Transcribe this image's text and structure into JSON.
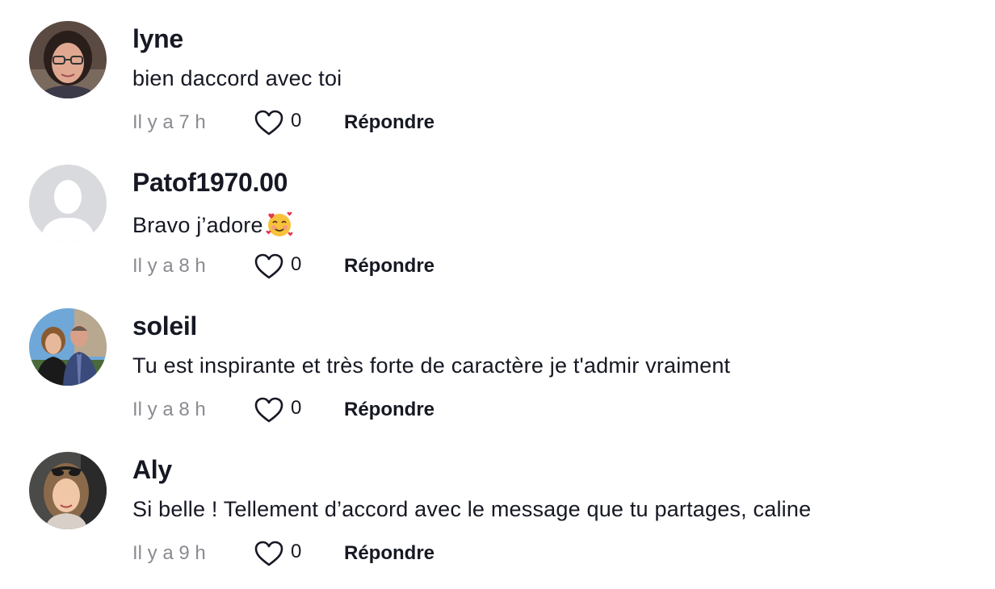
{
  "comments": [
    {
      "username": "lyne",
      "text": "bien daccord avec toi",
      "time": "Il y a 7 h",
      "likes": "0",
      "reply_label": "Répondre",
      "avatar": "photo-woman-glasses-avatar"
    },
    {
      "username": "Patof1970.00",
      "text": "Bravo j’adore",
      "emoji": "smiling-face-with-hearts",
      "time": "Il y a 8 h",
      "likes": "0",
      "reply_label": "Répondre",
      "avatar": "default-user-avatar"
    },
    {
      "username": "soleil",
      "text": "Tu est inspirante et très forte de caractère je t'admir vraiment",
      "time": "Il y a 8 h",
      "likes": "0",
      "reply_label": "Répondre",
      "avatar": "photo-couple-avatar"
    },
    {
      "username": "Aly",
      "text": "Si belle ! Tellement d’accord avec le message que tu partages, caline ",
      "time": "Il y a 9 h",
      "likes": "0",
      "reply_label": "Répondre",
      "avatar": "photo-woman-sunglasses-avatar"
    }
  ],
  "colors": {
    "text_primary": "#161823",
    "text_secondary": "#8a8b91",
    "default_avatar_bg": "#d9dadd"
  }
}
